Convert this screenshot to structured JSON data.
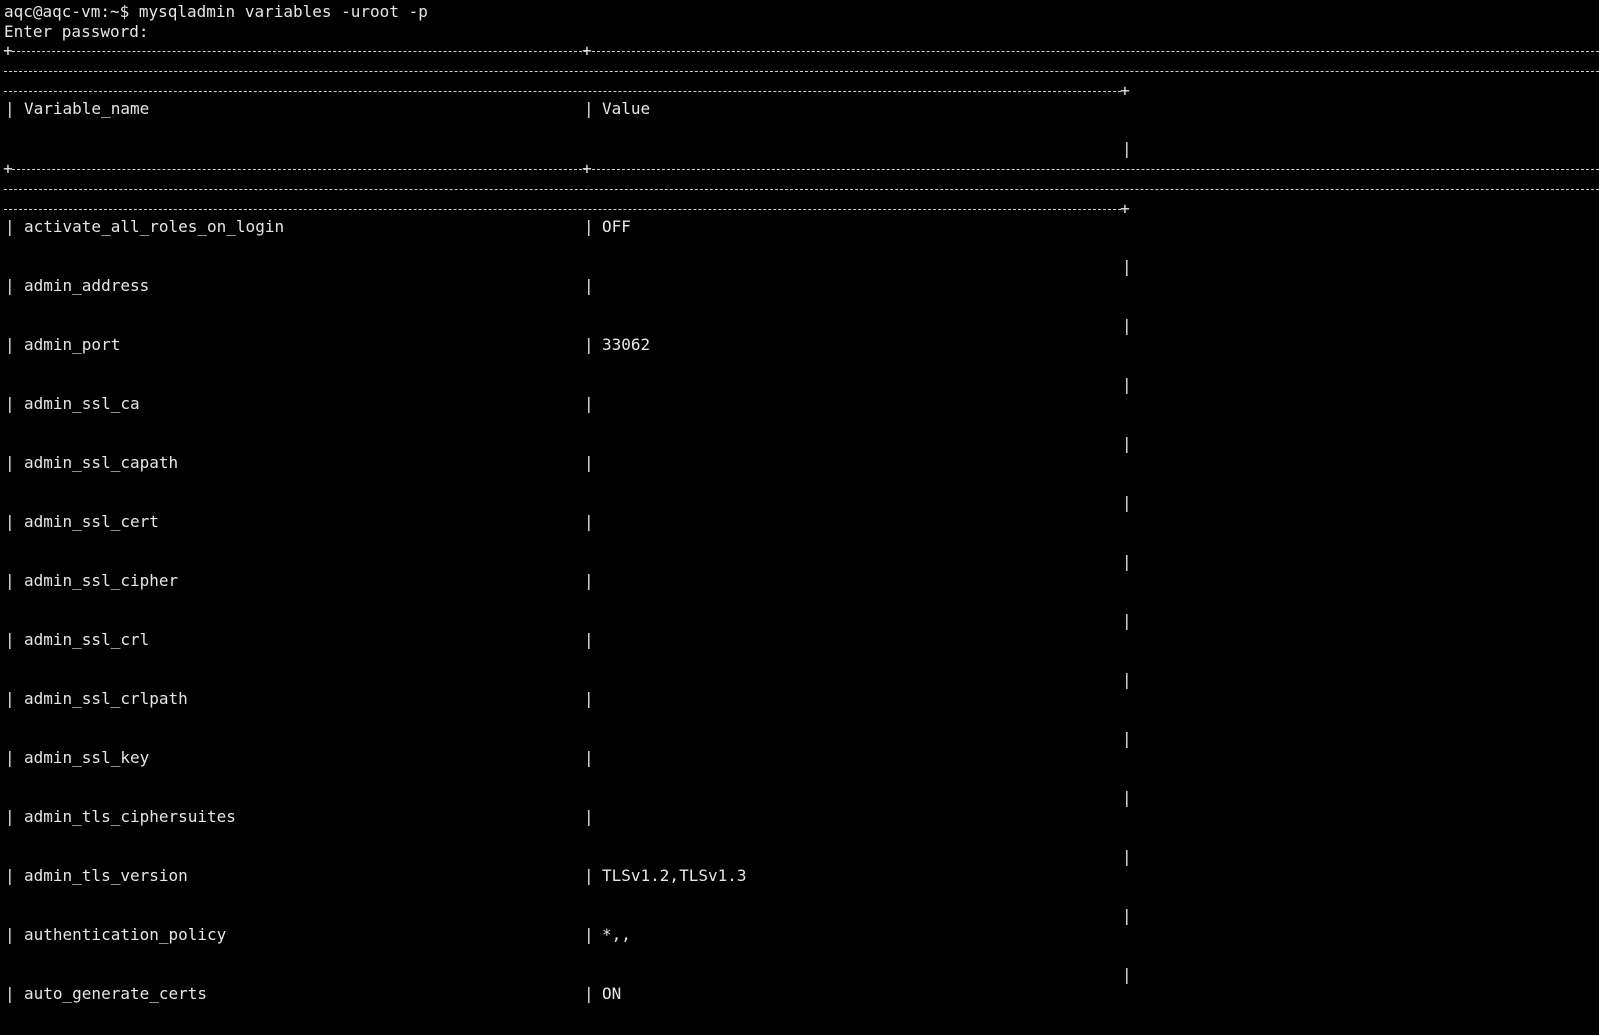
{
  "terminal": {
    "prompt": "aqc@aqc-vm:~$ mysqladmin variables -uroot -p",
    "password_prompt": "Enter password:",
    "header": {
      "col1": "Variable_name",
      "col2": "Value"
    },
    "rows": [
      {
        "name": "activate_all_roles_on_login",
        "value": "OFF"
      },
      {
        "name": "admin_address",
        "value": ""
      },
      {
        "name": "admin_port",
        "value": "33062"
      },
      {
        "name": "admin_ssl_ca",
        "value": ""
      },
      {
        "name": "admin_ssl_capath",
        "value": ""
      },
      {
        "name": "admin_ssl_cert",
        "value": ""
      },
      {
        "name": "admin_ssl_cipher",
        "value": ""
      },
      {
        "name": "admin_ssl_crl",
        "value": ""
      },
      {
        "name": "admin_ssl_crlpath",
        "value": ""
      },
      {
        "name": "admin_ssl_key",
        "value": ""
      },
      {
        "name": "admin_tls_ciphersuites",
        "value": ""
      },
      {
        "name": "admin_tls_version",
        "value": "TLSv1.2,TLSv1.3"
      },
      {
        "name": "authentication_policy",
        "value": "*,,"
      },
      {
        "name": "auto_generate_certs",
        "value": "ON"
      }
    ]
  }
}
